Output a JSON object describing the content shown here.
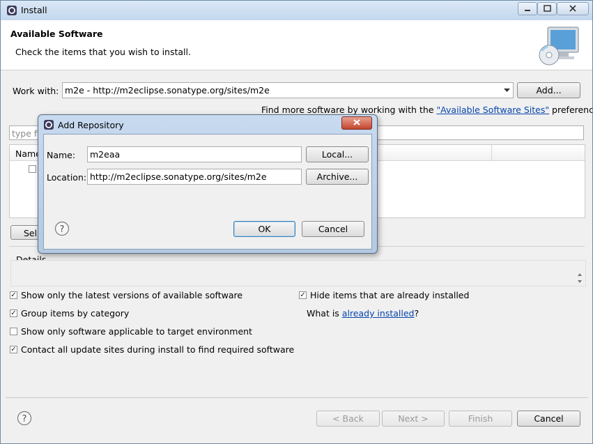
{
  "window": {
    "title": "Install",
    "controls": [
      "minimize-icon",
      "maximize-icon",
      "close-icon"
    ]
  },
  "header": {
    "title": "Available Software",
    "subtitle": "Check the items that you wish to install."
  },
  "work_with": {
    "label": "Work with:",
    "value": "m2e - http://m2eclipse.sonatype.org/sites/m2e",
    "add_button": "Add...",
    "find_more_prefix": "Find more software by working with the ",
    "find_more_link": "\"Available Software Sites\"",
    "find_more_suffix": " preferences."
  },
  "filter": {
    "placeholder": "type fi"
  },
  "table": {
    "column_name": "Name"
  },
  "select_all_partial": "Sel",
  "details_label": "Details",
  "options": {
    "latest_versions": {
      "label": "Show only the latest versions of available software",
      "checked": true
    },
    "hide_installed": {
      "label": "Hide items that are already installed",
      "checked": true
    },
    "group_by_category": {
      "label": "Group items by category",
      "checked": true
    },
    "what_is_prefix": "What is ",
    "already_installed_link": "already installed",
    "what_is_suffix": "?",
    "target_env": {
      "label": "Show only software applicable to target environment",
      "checked": false
    },
    "contact_sites": {
      "label": "Contact all update sites during install to find required software",
      "checked": true
    }
  },
  "footer": {
    "back": "< Back",
    "next": "Next >",
    "finish": "Finish",
    "cancel": "Cancel"
  },
  "dialog": {
    "title": "Add Repository",
    "name_label": "Name:",
    "name_value": "m2eaa",
    "location_label": "Location:",
    "location_value": "http://m2eclipse.sonatype.org/sites/m2e",
    "local_button": "Local...",
    "archive_button": "Archive...",
    "ok_button": "OK",
    "cancel_button": "Cancel"
  },
  "colors": {
    "link": "#0645ad",
    "title_bar": "#c3d7ee",
    "dialog_close": "#c4452e"
  }
}
